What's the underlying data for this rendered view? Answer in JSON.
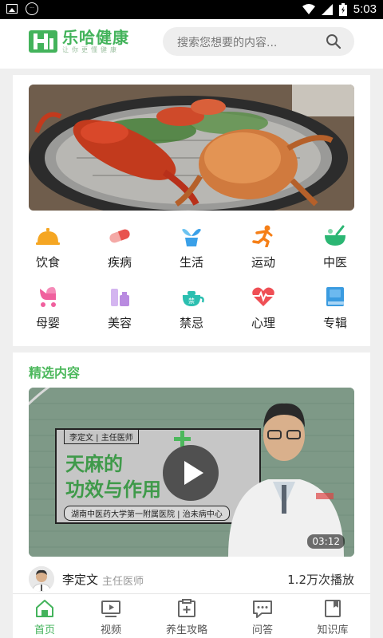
{
  "status_bar": {
    "time": "5:03"
  },
  "header": {
    "logo_title": "乐哈健康",
    "logo_subtitle": "让你更懂健康",
    "search_placeholder": "搜索您想要的内容..."
  },
  "banner": {
    "image": "lobster-crab-seafood-photo"
  },
  "categories": [
    {
      "label": "饮食",
      "icon": "food-cloche-icon",
      "color": "#f5a623"
    },
    {
      "label": "疾病",
      "icon": "pill-icon",
      "color": "#e8534e"
    },
    {
      "label": "生活",
      "icon": "plant-pot-icon",
      "color": "#3aa0e8"
    },
    {
      "label": "运动",
      "icon": "running-person-icon",
      "color": "#f57f17"
    },
    {
      "label": "中医",
      "icon": "herbal-bowl-icon",
      "color": "#2bb673"
    },
    {
      "label": "母婴",
      "icon": "baby-stroller-icon",
      "color": "#f0609e"
    },
    {
      "label": "美容",
      "icon": "cosmetics-icon",
      "color": "#b98be0"
    },
    {
      "label": "禁忌",
      "icon": "teapot-icon",
      "color": "#2bbfb0"
    },
    {
      "label": "心理",
      "icon": "heartbeat-icon",
      "color": "#ef4f55"
    },
    {
      "label": "专辑",
      "icon": "album-book-icon",
      "color": "#3a9be0"
    }
  ],
  "featured": {
    "section_title": "精选内容",
    "video": {
      "tag": "李定文 | 主任医师",
      "title_line1": "天麻的",
      "title_line2": "功效与作用",
      "hospital": "湖南中医药大学第一附属医院 | 治未病中心",
      "duration": "03:12"
    },
    "author_name": "李定文",
    "author_title": "主任医师",
    "plays": "1.2万次播放"
  },
  "tabs": [
    {
      "label": "首页",
      "icon": "home-icon",
      "active": true
    },
    {
      "label": "视频",
      "icon": "video-icon",
      "active": false
    },
    {
      "label": "养生攻略",
      "icon": "health-guide-icon",
      "active": false
    },
    {
      "label": "问答",
      "icon": "chat-bubble-icon",
      "active": false
    },
    {
      "label": "知识库",
      "icon": "bookmark-book-icon",
      "active": false
    }
  ],
  "colors": {
    "brand_green": "#43b35b",
    "section_green": "#4cb85c"
  }
}
